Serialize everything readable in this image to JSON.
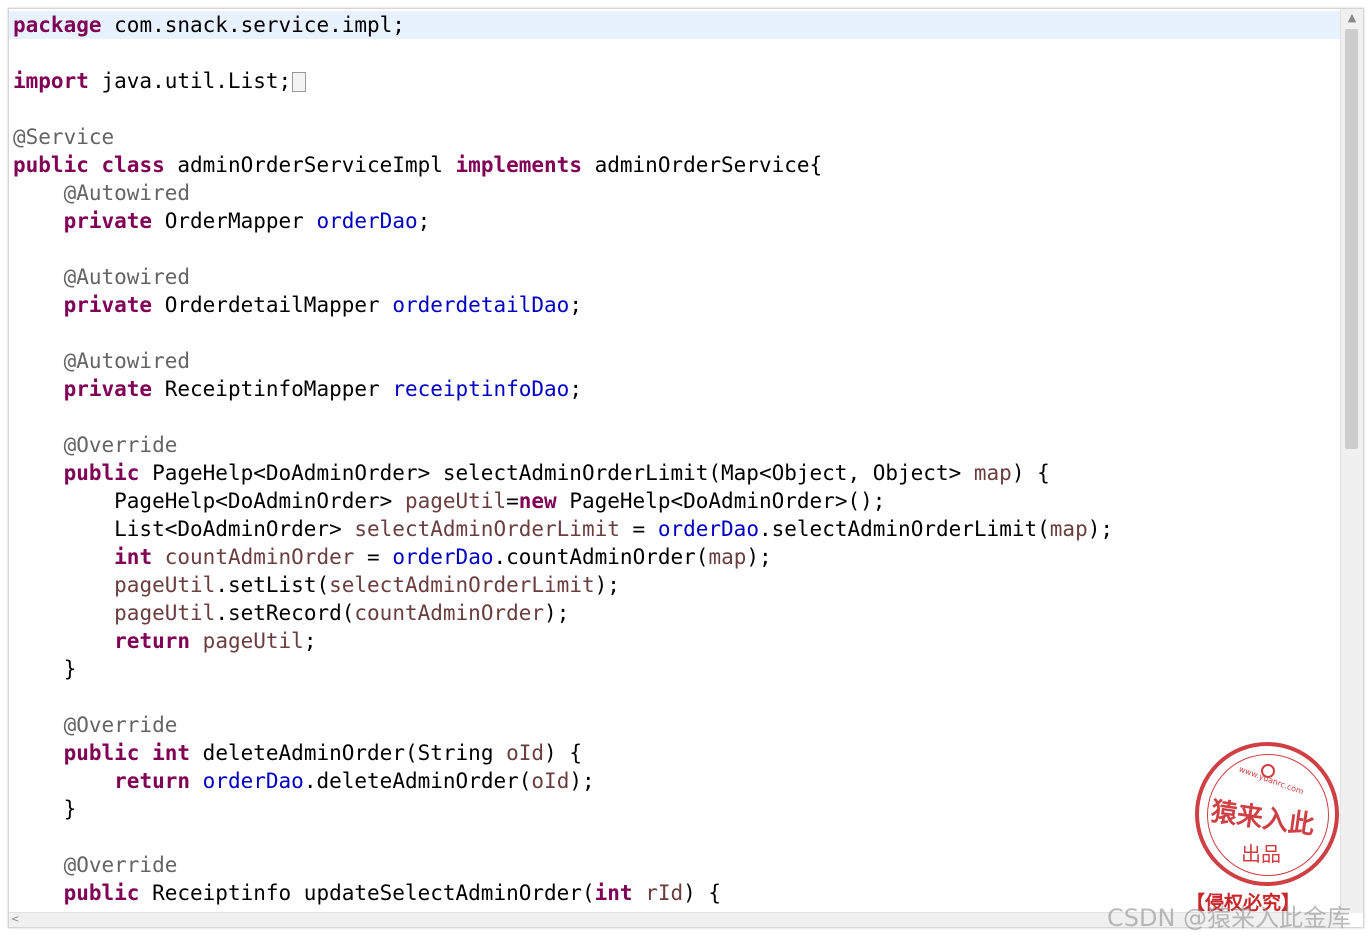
{
  "lines": [
    [
      {
        "t": "package",
        "c": "kw"
      },
      {
        "t": " com.snack.service.impl;"
      }
    ],
    [],
    [
      {
        "t": "import",
        "c": "kw"
      },
      {
        "t": " java.util.List;"
      }
    ],
    [],
    [
      {
        "t": "@Service",
        "c": "ann"
      }
    ],
    [
      {
        "t": "public",
        "c": "kw"
      },
      {
        "t": " "
      },
      {
        "t": "class",
        "c": "kw"
      },
      {
        "t": " adminOrderServiceImpl "
      },
      {
        "t": "implements",
        "c": "kw"
      },
      {
        "t": " adminOrderService{"
      }
    ],
    [
      {
        "t": "    "
      },
      {
        "t": "@Autowired",
        "c": "ann"
      }
    ],
    [
      {
        "t": "    "
      },
      {
        "t": "private",
        "c": "kw"
      },
      {
        "t": " OrderMapper "
      },
      {
        "t": "orderDao",
        "c": "fld"
      },
      {
        "t": ";"
      }
    ],
    [],
    [
      {
        "t": "    "
      },
      {
        "t": "@Autowired",
        "c": "ann"
      }
    ],
    [
      {
        "t": "    "
      },
      {
        "t": "private",
        "c": "kw"
      },
      {
        "t": " OrderdetailMapper "
      },
      {
        "t": "orderdetailDao",
        "c": "fld"
      },
      {
        "t": ";"
      }
    ],
    [],
    [
      {
        "t": "    "
      },
      {
        "t": "@Autowired",
        "c": "ann"
      }
    ],
    [
      {
        "t": "    "
      },
      {
        "t": "private",
        "c": "kw"
      },
      {
        "t": " ReceiptinfoMapper "
      },
      {
        "t": "receiptinfoDao",
        "c": "fld"
      },
      {
        "t": ";"
      }
    ],
    [],
    [
      {
        "t": "    "
      },
      {
        "t": "@Override",
        "c": "ann"
      }
    ],
    [
      {
        "t": "    "
      },
      {
        "t": "public",
        "c": "kw"
      },
      {
        "t": " PageHelp<DoAdminOrder> selectAdminOrderLimit(Map<Object, Object> "
      },
      {
        "t": "map",
        "c": "loc"
      },
      {
        "t": ") {"
      }
    ],
    [
      {
        "t": "        PageHelp<DoAdminOrder> "
      },
      {
        "t": "pageUtil",
        "c": "loc"
      },
      {
        "t": "="
      },
      {
        "t": "new",
        "c": "kw"
      },
      {
        "t": " PageHelp<DoAdminOrder>();"
      }
    ],
    [
      {
        "t": "        List<DoAdminOrder> "
      },
      {
        "t": "selectAdminOrderLimit",
        "c": "loc"
      },
      {
        "t": " = "
      },
      {
        "t": "orderDao",
        "c": "fld"
      },
      {
        "t": ".selectAdminOrderLimit("
      },
      {
        "t": "map",
        "c": "loc"
      },
      {
        "t": ");"
      }
    ],
    [
      {
        "t": "        "
      },
      {
        "t": "int",
        "c": "kw"
      },
      {
        "t": " "
      },
      {
        "t": "countAdminOrder",
        "c": "loc"
      },
      {
        "t": " = "
      },
      {
        "t": "orderDao",
        "c": "fld"
      },
      {
        "t": ".countAdminOrder("
      },
      {
        "t": "map",
        "c": "loc"
      },
      {
        "t": ");"
      }
    ],
    [
      {
        "t": "        "
      },
      {
        "t": "pageUtil",
        "c": "loc"
      },
      {
        "t": ".setList("
      },
      {
        "t": "selectAdminOrderLimit",
        "c": "loc"
      },
      {
        "t": ");"
      }
    ],
    [
      {
        "t": "        "
      },
      {
        "t": "pageUtil",
        "c": "loc"
      },
      {
        "t": ".setRecord("
      },
      {
        "t": "countAdminOrder",
        "c": "loc"
      },
      {
        "t": ");"
      }
    ],
    [
      {
        "t": "        "
      },
      {
        "t": "return",
        "c": "kw"
      },
      {
        "t": " "
      },
      {
        "t": "pageUtil",
        "c": "loc"
      },
      {
        "t": ";"
      }
    ],
    [
      {
        "t": "    }"
      }
    ],
    [],
    [
      {
        "t": "    "
      },
      {
        "t": "@Override",
        "c": "ann"
      }
    ],
    [
      {
        "t": "    "
      },
      {
        "t": "public",
        "c": "kw"
      },
      {
        "t": " "
      },
      {
        "t": "int",
        "c": "kw"
      },
      {
        "t": " deleteAdminOrder(String "
      },
      {
        "t": "oId",
        "c": "loc"
      },
      {
        "t": ") {"
      }
    ],
    [
      {
        "t": "        "
      },
      {
        "t": "return",
        "c": "kw"
      },
      {
        "t": " "
      },
      {
        "t": "orderDao",
        "c": "fld"
      },
      {
        "t": ".deleteAdminOrder("
      },
      {
        "t": "oId",
        "c": "loc"
      },
      {
        "t": ");"
      }
    ],
    [
      {
        "t": "    }"
      }
    ],
    [],
    [
      {
        "t": "    "
      },
      {
        "t": "@Override",
        "c": "ann"
      }
    ],
    [
      {
        "t": "    "
      },
      {
        "t": "public",
        "c": "kw"
      },
      {
        "t": " Receiptinfo updateSelectAdminOrder("
      },
      {
        "t": "int",
        "c": "kw"
      },
      {
        "t": " "
      },
      {
        "t": "rId",
        "c": "loc"
      },
      {
        "t": ") {"
      }
    ]
  ],
  "current_line": 0,
  "folded_import_marker_line": 2,
  "stamp": {
    "url": "www.yuanrc.com",
    "main": "猿来入此",
    "sub": "出品",
    "caption": "【侵权必究】"
  },
  "watermark": "CSDN @猿来入此金库"
}
